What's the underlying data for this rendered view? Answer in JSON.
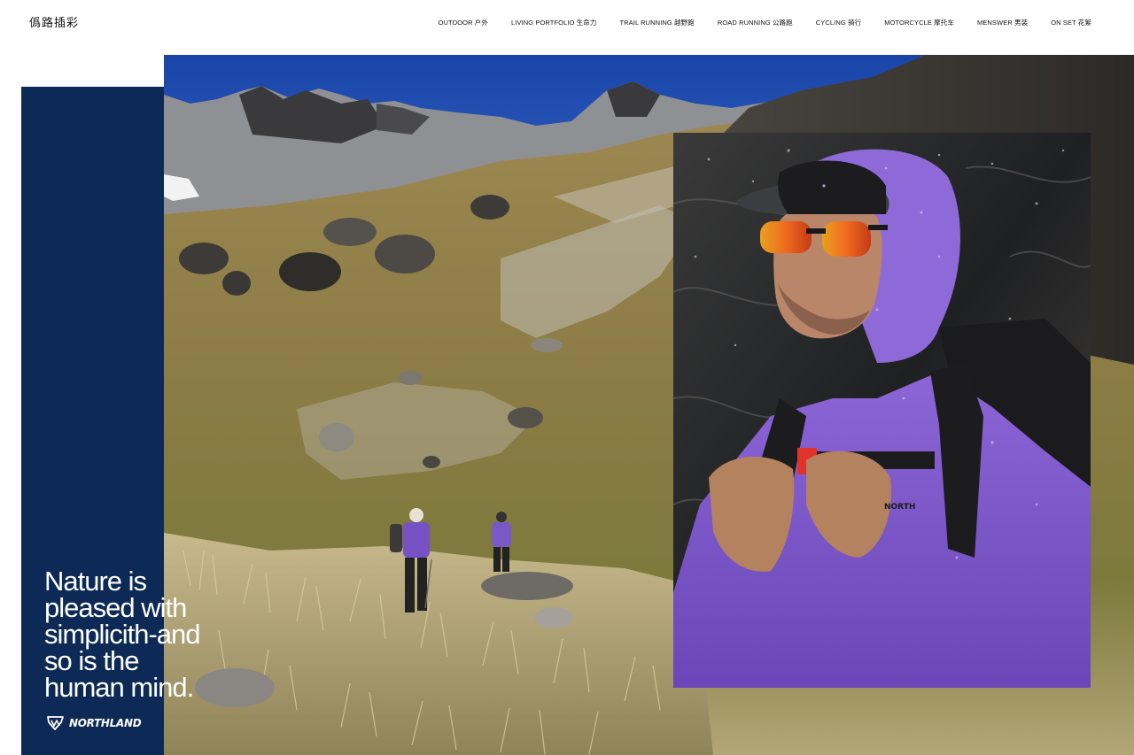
{
  "header": {
    "logo": "僞路插彩",
    "nav": [
      "OUTDOOR 户外",
      "LIVING PORTFOLIO 生命力",
      "TRAIL RUNNING 越野跑",
      "ROAD RUNNING 公路跑",
      "CYCLING 骑行",
      "MOTORCYCLE 摩托车",
      "MENSWER 男装",
      "ON SET 花絮"
    ]
  },
  "hero": {
    "headline_lines": [
      "Nature is",
      "pleased with",
      "simplicith-and",
      "so is the",
      "human mind."
    ],
    "brand": "NORTHLAND",
    "brand_icon": "northland-logo-icon"
  },
  "colors": {
    "panel": "#0c2a55",
    "sky": "#1f4fb3",
    "jacket": "#7a55c8",
    "background": "#ffffff"
  },
  "images": {
    "landscape": "landscape-photo",
    "portrait": "portrait-photo"
  }
}
